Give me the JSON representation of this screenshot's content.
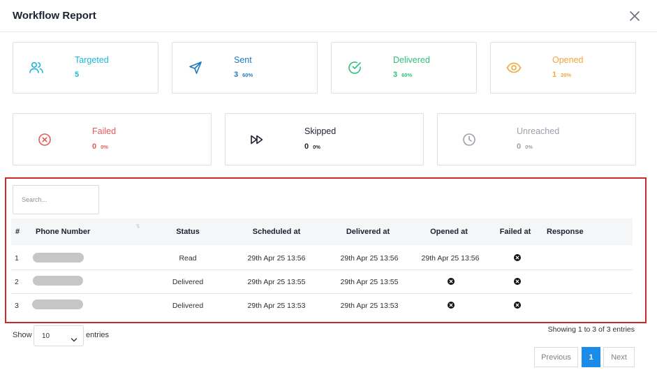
{
  "header": {
    "title": "Workflow Report"
  },
  "stats": {
    "targeted": {
      "label": "Targeted",
      "value": "5",
      "percent": ""
    },
    "sent": {
      "label": "Sent",
      "value": "3",
      "percent": "60%"
    },
    "delivered": {
      "label": "Delivered",
      "value": "3",
      "percent": "60%"
    },
    "opened": {
      "label": "Opened",
      "value": "1",
      "percent": "20%"
    },
    "failed": {
      "label": "Failed",
      "value": "0",
      "percent": "0%"
    },
    "skipped": {
      "label": "Skipped",
      "value": "0",
      "percent": "0%"
    },
    "unreached": {
      "label": "Unreached",
      "value": "0",
      "percent": "0%"
    }
  },
  "colors": {
    "targeted": "#1ab8d6",
    "sent": "#1a7ac4",
    "delivered": "#2fc07c",
    "opened": "#f0a73a",
    "failed": "#e35a5a",
    "skipped": "#1d2230",
    "unreached": "#9aa0a8",
    "highlight_border": "#cc2a2a",
    "pagination_active": "#1a8be8"
  },
  "icons": {
    "targeted": "users-icon",
    "sent": "send-icon",
    "delivered": "check-circle-icon",
    "opened": "eye-icon",
    "failed": "x-circle-icon",
    "skipped": "fast-forward-icon",
    "unreached": "clock-icon",
    "close": "close-icon",
    "not_available": "x-circle-filled-icon"
  },
  "table": {
    "search_placeholder": "Search...",
    "columns": [
      "#",
      "Phone Number",
      "Status",
      "Scheduled at",
      "Delivered at",
      "Opened at",
      "Failed at",
      "Response"
    ],
    "rows": [
      {
        "index": "1",
        "phone": "",
        "status": "Read",
        "scheduled": "29th Apr 25 13:56",
        "delivered": "29th Apr 25 13:56",
        "opened": "29th Apr 25 13:56",
        "failed": "",
        "response": ""
      },
      {
        "index": "2",
        "phone": "",
        "status": "Delivered",
        "scheduled": "29th Apr 25 13:55",
        "delivered": "29th Apr 25 13:55",
        "opened": "",
        "failed": "",
        "response": ""
      },
      {
        "index": "3",
        "phone": "",
        "status": "Delivered",
        "scheduled": "29th Apr 25 13:53",
        "delivered": "29th Apr 25 13:53",
        "opened": "",
        "failed": "",
        "response": ""
      }
    ]
  },
  "footer": {
    "show_label": "Show",
    "entries_value": "10",
    "entries_label": "entries",
    "info": "Showing 1 to 3 of 3 entries",
    "previous": "Previous",
    "page": "1",
    "next": "Next"
  }
}
